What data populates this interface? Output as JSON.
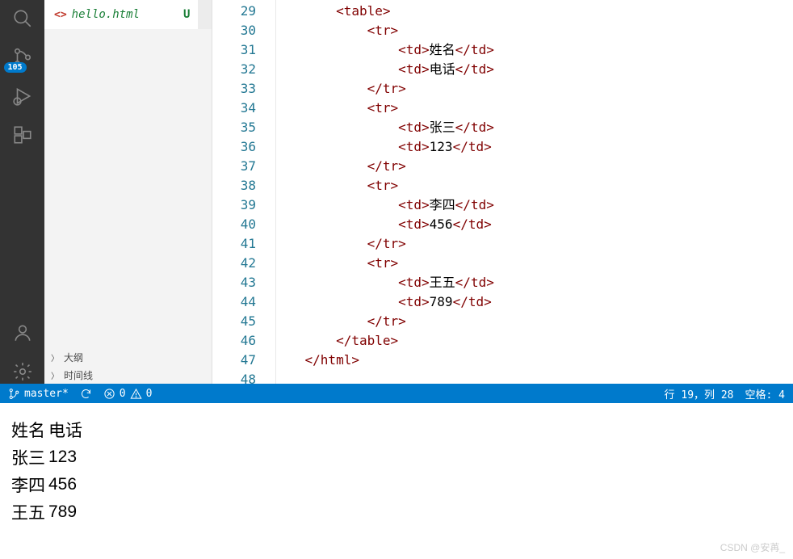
{
  "activity": {
    "badge": "105"
  },
  "tab": {
    "icon": "<>",
    "filename": "hello.html",
    "status": "U"
  },
  "outline": {
    "label1": "大纲",
    "label2": "时间线"
  },
  "gutter_start": 29,
  "gutter_end": 48,
  "code_lines": [
    {
      "indent": 2,
      "open": "<table>",
      "text": "",
      "close": ""
    },
    {
      "indent": 3,
      "open": "<tr>",
      "text": "",
      "close": ""
    },
    {
      "indent": 4,
      "open": "<td>",
      "text": "姓名",
      "close": "</td>"
    },
    {
      "indent": 4,
      "open": "<td>",
      "text": "电话",
      "close": "</td>"
    },
    {
      "indent": 3,
      "open": "</tr>",
      "text": "",
      "close": ""
    },
    {
      "indent": 3,
      "open": "<tr>",
      "text": "",
      "close": ""
    },
    {
      "indent": 4,
      "open": "<td>",
      "text": "张三",
      "close": "</td>"
    },
    {
      "indent": 4,
      "open": "<td>",
      "text": "123",
      "close": "</td>"
    },
    {
      "indent": 3,
      "open": "</tr>",
      "text": "",
      "close": ""
    },
    {
      "indent": 3,
      "open": "<tr>",
      "text": "",
      "close": ""
    },
    {
      "indent": 4,
      "open": "<td>",
      "text": "李四",
      "close": "</td>"
    },
    {
      "indent": 4,
      "open": "<td>",
      "text": "456",
      "close": "</td>"
    },
    {
      "indent": 3,
      "open": "</tr>",
      "text": "",
      "close": ""
    },
    {
      "indent": 3,
      "open": "<tr>",
      "text": "",
      "close": ""
    },
    {
      "indent": 4,
      "open": "<td>",
      "text": "王五",
      "close": "</td>"
    },
    {
      "indent": 4,
      "open": "<td>",
      "text": "789",
      "close": "</td>"
    },
    {
      "indent": 3,
      "open": "</tr>",
      "text": "",
      "close": ""
    },
    {
      "indent": 2,
      "open": "</table>",
      "text": "",
      "close": ""
    },
    {
      "indent": 1,
      "open": "</html>",
      "text": "",
      "close": ""
    },
    {
      "indent": 0,
      "open": "",
      "text": "",
      "close": ""
    }
  ],
  "statusbar": {
    "branch": "master*",
    "errors": "0",
    "warnings": "0",
    "cursor": "行 19，列 28",
    "spaces": "空格: 4"
  },
  "preview_table": [
    [
      "姓名",
      "电话"
    ],
    [
      "张三",
      "123"
    ],
    [
      "李四",
      "456"
    ],
    [
      "王五",
      "789"
    ]
  ],
  "watermark": "CSDN @安苒_"
}
